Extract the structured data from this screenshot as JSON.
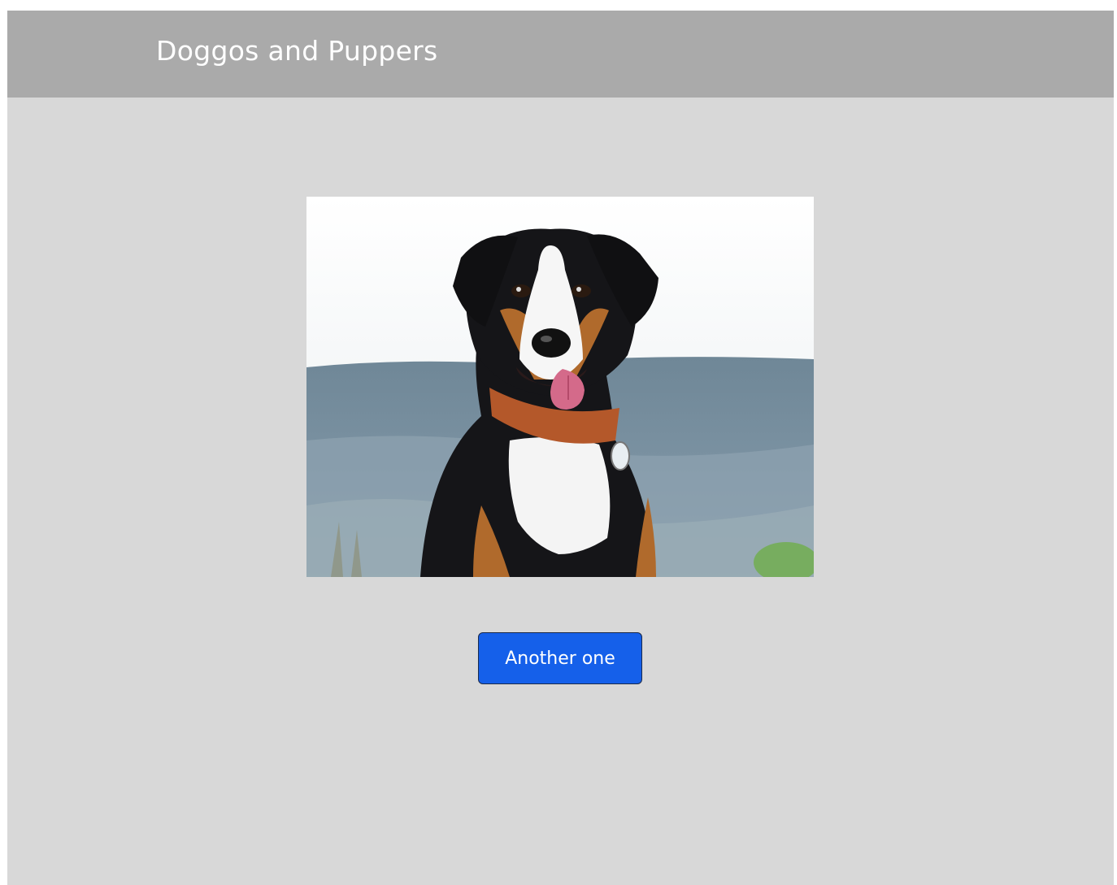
{
  "header": {
    "title": "Doggos and Puppers",
    "background_color": "#aaaaaa"
  },
  "main": {
    "background_color": "#d8d8d8",
    "photo": {
      "subject": "dog-photo"
    },
    "next_button": {
      "label": "Another one",
      "color": "#1560ea"
    }
  }
}
